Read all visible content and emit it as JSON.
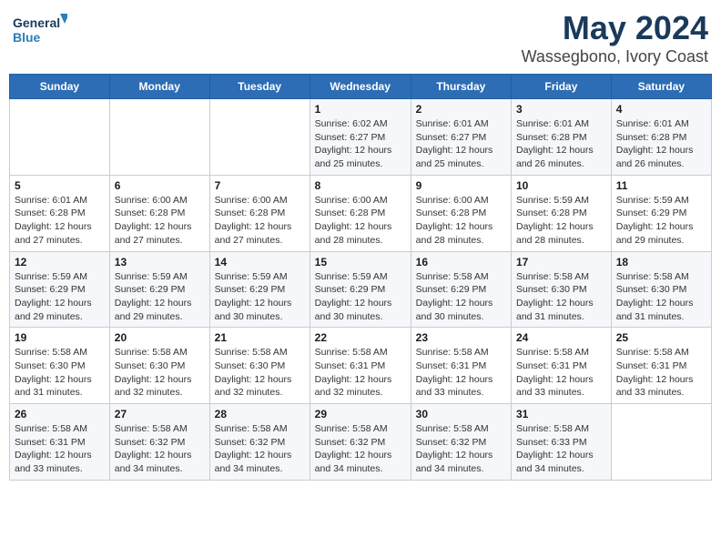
{
  "header": {
    "logo_line1": "General",
    "logo_line2": "Blue",
    "month": "May 2024",
    "location": "Wassegbono, Ivory Coast"
  },
  "weekdays": [
    "Sunday",
    "Monday",
    "Tuesday",
    "Wednesday",
    "Thursday",
    "Friday",
    "Saturday"
  ],
  "weeks": [
    [
      {
        "day": "",
        "info": ""
      },
      {
        "day": "",
        "info": ""
      },
      {
        "day": "",
        "info": ""
      },
      {
        "day": "1",
        "info": "Sunrise: 6:02 AM\nSunset: 6:27 PM\nDaylight: 12 hours and 25 minutes."
      },
      {
        "day": "2",
        "info": "Sunrise: 6:01 AM\nSunset: 6:27 PM\nDaylight: 12 hours and 25 minutes."
      },
      {
        "day": "3",
        "info": "Sunrise: 6:01 AM\nSunset: 6:28 PM\nDaylight: 12 hours and 26 minutes."
      },
      {
        "day": "4",
        "info": "Sunrise: 6:01 AM\nSunset: 6:28 PM\nDaylight: 12 hours and 26 minutes."
      }
    ],
    [
      {
        "day": "5",
        "info": "Sunrise: 6:01 AM\nSunset: 6:28 PM\nDaylight: 12 hours and 27 minutes."
      },
      {
        "day": "6",
        "info": "Sunrise: 6:00 AM\nSunset: 6:28 PM\nDaylight: 12 hours and 27 minutes."
      },
      {
        "day": "7",
        "info": "Sunrise: 6:00 AM\nSunset: 6:28 PM\nDaylight: 12 hours and 27 minutes."
      },
      {
        "day": "8",
        "info": "Sunrise: 6:00 AM\nSunset: 6:28 PM\nDaylight: 12 hours and 28 minutes."
      },
      {
        "day": "9",
        "info": "Sunrise: 6:00 AM\nSunset: 6:28 PM\nDaylight: 12 hours and 28 minutes."
      },
      {
        "day": "10",
        "info": "Sunrise: 5:59 AM\nSunset: 6:28 PM\nDaylight: 12 hours and 28 minutes."
      },
      {
        "day": "11",
        "info": "Sunrise: 5:59 AM\nSunset: 6:29 PM\nDaylight: 12 hours and 29 minutes."
      }
    ],
    [
      {
        "day": "12",
        "info": "Sunrise: 5:59 AM\nSunset: 6:29 PM\nDaylight: 12 hours and 29 minutes."
      },
      {
        "day": "13",
        "info": "Sunrise: 5:59 AM\nSunset: 6:29 PM\nDaylight: 12 hours and 29 minutes."
      },
      {
        "day": "14",
        "info": "Sunrise: 5:59 AM\nSunset: 6:29 PM\nDaylight: 12 hours and 30 minutes."
      },
      {
        "day": "15",
        "info": "Sunrise: 5:59 AM\nSunset: 6:29 PM\nDaylight: 12 hours and 30 minutes."
      },
      {
        "day": "16",
        "info": "Sunrise: 5:58 AM\nSunset: 6:29 PM\nDaylight: 12 hours and 30 minutes."
      },
      {
        "day": "17",
        "info": "Sunrise: 5:58 AM\nSunset: 6:30 PM\nDaylight: 12 hours and 31 minutes."
      },
      {
        "day": "18",
        "info": "Sunrise: 5:58 AM\nSunset: 6:30 PM\nDaylight: 12 hours and 31 minutes."
      }
    ],
    [
      {
        "day": "19",
        "info": "Sunrise: 5:58 AM\nSunset: 6:30 PM\nDaylight: 12 hours and 31 minutes."
      },
      {
        "day": "20",
        "info": "Sunrise: 5:58 AM\nSunset: 6:30 PM\nDaylight: 12 hours and 32 minutes."
      },
      {
        "day": "21",
        "info": "Sunrise: 5:58 AM\nSunset: 6:30 PM\nDaylight: 12 hours and 32 minutes."
      },
      {
        "day": "22",
        "info": "Sunrise: 5:58 AM\nSunset: 6:31 PM\nDaylight: 12 hours and 32 minutes."
      },
      {
        "day": "23",
        "info": "Sunrise: 5:58 AM\nSunset: 6:31 PM\nDaylight: 12 hours and 33 minutes."
      },
      {
        "day": "24",
        "info": "Sunrise: 5:58 AM\nSunset: 6:31 PM\nDaylight: 12 hours and 33 minutes."
      },
      {
        "day": "25",
        "info": "Sunrise: 5:58 AM\nSunset: 6:31 PM\nDaylight: 12 hours and 33 minutes."
      }
    ],
    [
      {
        "day": "26",
        "info": "Sunrise: 5:58 AM\nSunset: 6:31 PM\nDaylight: 12 hours and 33 minutes."
      },
      {
        "day": "27",
        "info": "Sunrise: 5:58 AM\nSunset: 6:32 PM\nDaylight: 12 hours and 34 minutes."
      },
      {
        "day": "28",
        "info": "Sunrise: 5:58 AM\nSunset: 6:32 PM\nDaylight: 12 hours and 34 minutes."
      },
      {
        "day": "29",
        "info": "Sunrise: 5:58 AM\nSunset: 6:32 PM\nDaylight: 12 hours and 34 minutes."
      },
      {
        "day": "30",
        "info": "Sunrise: 5:58 AM\nSunset: 6:32 PM\nDaylight: 12 hours and 34 minutes."
      },
      {
        "day": "31",
        "info": "Sunrise: 5:58 AM\nSunset: 6:33 PM\nDaylight: 12 hours and 34 minutes."
      },
      {
        "day": "",
        "info": ""
      }
    ]
  ]
}
